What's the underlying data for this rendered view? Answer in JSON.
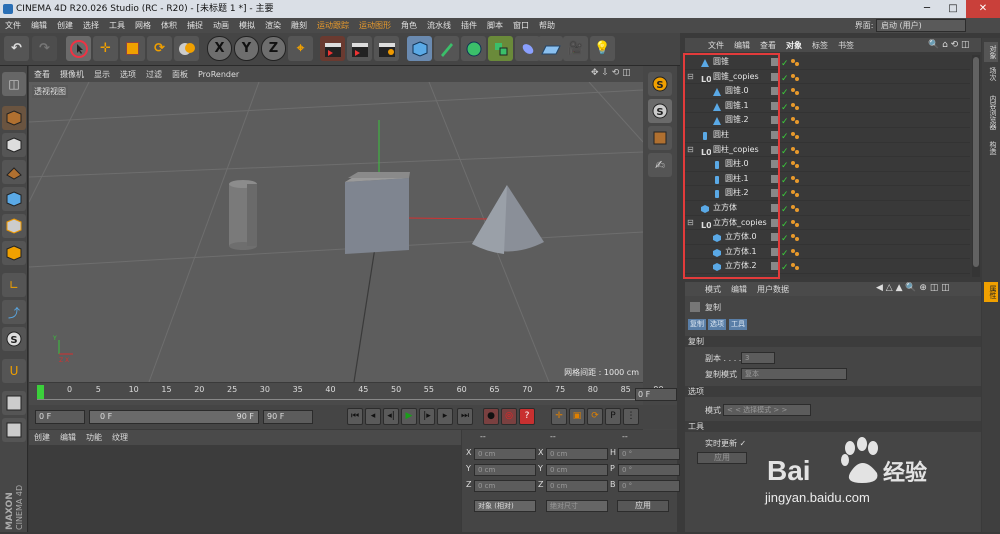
{
  "window": {
    "title": "CINEMA 4D R20.026 Studio (RC - R20) - [未标题 1 *] - 主要",
    "buttons": [
      "─",
      "□",
      "✕"
    ]
  },
  "menubar": {
    "items": [
      "文件",
      "编辑",
      "创建",
      "选择",
      "工具",
      "网格",
      "体积",
      "捕捉",
      "动画",
      "模拟",
      "渲染",
      "雕刻",
      "运动跟踪",
      "运动图形",
      "角色",
      "流水线",
      "插件",
      "脚本",
      "窗口",
      "帮助"
    ],
    "layout_label": "界面:",
    "layout_value": "启动 (用户)"
  },
  "viewport": {
    "menu": [
      "查看",
      "摄像机",
      "显示",
      "选项",
      "过滤",
      "面板",
      "ProRender"
    ],
    "label": "透视视图",
    "grid_label": "网格间距 : 1000 cm"
  },
  "timeline": {
    "ticks": [
      "0",
      "5",
      "10",
      "15",
      "20",
      "25",
      "30",
      "35",
      "40",
      "45",
      "50",
      "55",
      "60",
      "65",
      "70",
      "75",
      "80",
      "85",
      "90"
    ],
    "current_frame": "0 F"
  },
  "playback": {
    "start": "0 F",
    "range_start": "0 F",
    "range_end": "90 F",
    "end": "90 F"
  },
  "material_manager": {
    "menu": [
      "创建",
      "编辑",
      "功能",
      "纹理"
    ]
  },
  "coordinates": {
    "headers": [
      "--",
      "--",
      "--"
    ],
    "rows": [
      {
        "axis": "X",
        "pos": "0 cm",
        "axis2": "X",
        "size": "0 cm",
        "rot_label": "H",
        "rot": "0 °"
      },
      {
        "axis": "Y",
        "pos": "0 cm",
        "axis2": "Y",
        "size": "0 cm",
        "rot_label": "P",
        "rot": "0 °"
      },
      {
        "axis": "Z",
        "pos": "0 cm",
        "axis2": "Z",
        "size": "0 cm",
        "rot_label": "B",
        "rot": "0 °"
      }
    ],
    "mode1": "对象 (相对)",
    "mode2": "绝对尺寸",
    "apply": "应用"
  },
  "object_manager": {
    "menu": [
      "文件",
      "编辑",
      "查看",
      "对象",
      "标签",
      "书签"
    ],
    "objects": [
      {
        "name": "圆锥",
        "indent": 0,
        "icon": "cone"
      },
      {
        "name": "圆锥_copies",
        "indent": 0,
        "icon": "null"
      },
      {
        "name": "圆锥.0",
        "indent": 1,
        "icon": "cone"
      },
      {
        "name": "圆锥.1",
        "indent": 1,
        "icon": "cone"
      },
      {
        "name": "圆锥.2",
        "indent": 1,
        "icon": "cone"
      },
      {
        "name": "圆柱",
        "indent": 0,
        "icon": "cylinder"
      },
      {
        "name": "圆柱_copies",
        "indent": 0,
        "icon": "null"
      },
      {
        "name": "圆柱.0",
        "indent": 1,
        "icon": "cylinder"
      },
      {
        "name": "圆柱.1",
        "indent": 1,
        "icon": "cylinder"
      },
      {
        "name": "圆柱.2",
        "indent": 1,
        "icon": "cylinder"
      },
      {
        "name": "立方体",
        "indent": 0,
        "icon": "cube"
      },
      {
        "name": "立方体_copies",
        "indent": 0,
        "icon": "null"
      },
      {
        "name": "立方体.0",
        "indent": 1,
        "icon": "cube"
      },
      {
        "name": "立方体.1",
        "indent": 1,
        "icon": "cube"
      },
      {
        "name": "立方体.2",
        "indent": 1,
        "icon": "cube"
      }
    ]
  },
  "attributes": {
    "menu": [
      "模式",
      "编辑",
      "用户数据"
    ],
    "title": "复制",
    "tabs": [
      "复制",
      "选项",
      "工具"
    ],
    "section_copy": "复制",
    "copies_label": "副本 . . . .",
    "copies_value": "3",
    "copy_mode_label": "复制模式",
    "copy_mode_value": "复本",
    "section_options": "选项",
    "mode_label": "模式",
    "mode_value": "< < 选择模式 > >",
    "section_tools": "工具",
    "realtime_label": "实时更新 ✓",
    "apply_label": "应用"
  },
  "right_tabs": [
    "对象",
    "场次",
    "内容浏览器",
    "构造"
  ],
  "attr_right_tab": "属性",
  "colors": {
    "accent_orange": "#e89a2c",
    "red_highlight": "#e23b3b",
    "tab_blue": "#5a7fa8"
  },
  "watermark": {
    "brand": "Bai du 经验",
    "url": "jingyan.baidu.com"
  }
}
